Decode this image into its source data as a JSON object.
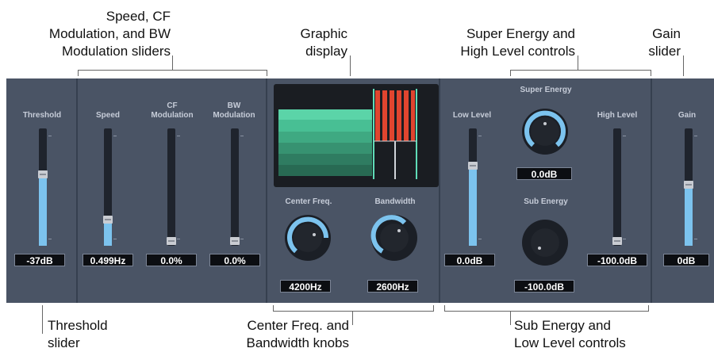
{
  "callouts": {
    "speed_cf_bw": [
      "Speed, CF",
      "Modulation, and BW",
      "Modulation sliders"
    ],
    "graphic": [
      "Graphic",
      "display"
    ],
    "super_high": [
      "Super Energy and",
      "High Level controls"
    ],
    "gain": [
      "Gain",
      "slider"
    ],
    "threshold": [
      "Threshold",
      "slider"
    ],
    "center_bw": [
      "Center Freq. and",
      "Bandwidth knobs"
    ],
    "sub_low": [
      "Sub Energy and",
      "Low Level controls"
    ]
  },
  "plugin": {
    "threshold": {
      "label": "Threshold",
      "value": "-37dB",
      "level": 0.62
    },
    "speed": {
      "label": "Speed",
      "value": "0.499Hz",
      "level": 0.2
    },
    "cf_mod": {
      "label": [
        "CF",
        "Modulation"
      ],
      "value": "0.0%",
      "level": 0.0
    },
    "bw_mod": {
      "label": [
        "BW",
        "Modulation"
      ],
      "value": "0.0%",
      "level": 0.0
    },
    "center_freq": {
      "label": "Center Freq.",
      "value": "4200Hz"
    },
    "bandwidth": {
      "label": "Bandwidth",
      "value": "2600Hz"
    },
    "low_level": {
      "label": "Low Level",
      "value": "0.0dB",
      "level": 0.7
    },
    "super_energy": {
      "label": "Super Energy",
      "value": "0.0dB"
    },
    "sub_energy": {
      "label": "Sub Energy",
      "value": "-100.0dB"
    },
    "high_level": {
      "label": "High Level",
      "value": "-100.0dB",
      "level": 0.0
    },
    "gain": {
      "label": "Gain",
      "value": "0dB",
      "level": 0.52
    }
  },
  "colors": {
    "panel": "#4a5465",
    "slider_fill": "#7cc3ee",
    "display_green": "#4fc79b",
    "display_red": "#e0452f"
  }
}
